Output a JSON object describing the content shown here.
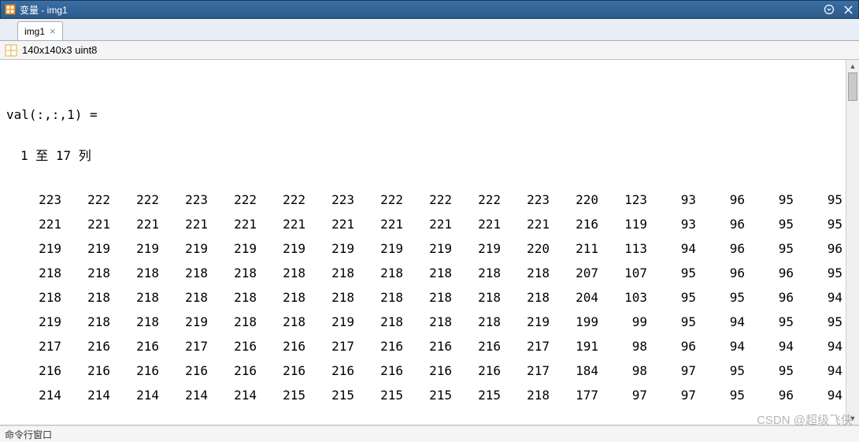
{
  "window": {
    "title": "变量 - img1"
  },
  "tab": {
    "label": "img1"
  },
  "toolbar": {
    "info": "140x140x3 uint8"
  },
  "content": {
    "header": "val(:,:,1) =",
    "subheader": "1 至 17 列",
    "rows": [
      [
        "223",
        "222",
        "222",
        "223",
        "222",
        "222",
        "223",
        "222",
        "222",
        "222",
        "223",
        "220",
        "123",
        "93",
        "96",
        "95",
        "95"
      ],
      [
        "221",
        "221",
        "221",
        "221",
        "221",
        "221",
        "221",
        "221",
        "221",
        "221",
        "221",
        "216",
        "119",
        "93",
        "96",
        "95",
        "95"
      ],
      [
        "219",
        "219",
        "219",
        "219",
        "219",
        "219",
        "219",
        "219",
        "219",
        "219",
        "220",
        "211",
        "113",
        "94",
        "96",
        "95",
        "96"
      ],
      [
        "218",
        "218",
        "218",
        "218",
        "218",
        "218",
        "218",
        "218",
        "218",
        "218",
        "218",
        "207",
        "107",
        "95",
        "96",
        "96",
        "95"
      ],
      [
        "218",
        "218",
        "218",
        "218",
        "218",
        "218",
        "218",
        "218",
        "218",
        "218",
        "218",
        "204",
        "103",
        "95",
        "95",
        "96",
        "94"
      ],
      [
        "219",
        "218",
        "218",
        "219",
        "218",
        "218",
        "219",
        "218",
        "218",
        "218",
        "219",
        "199",
        "99",
        "95",
        "94",
        "95",
        "95"
      ],
      [
        "217",
        "216",
        "216",
        "217",
        "216",
        "216",
        "217",
        "216",
        "216",
        "216",
        "217",
        "191",
        "98",
        "96",
        "94",
        "94",
        "94"
      ],
      [
        "216",
        "216",
        "216",
        "216",
        "216",
        "216",
        "216",
        "216",
        "216",
        "216",
        "217",
        "184",
        "98",
        "97",
        "95",
        "95",
        "94"
      ],
      [
        "214",
        "214",
        "214",
        "214",
        "214",
        "215",
        "215",
        "215",
        "215",
        "215",
        "218",
        "177",
        "97",
        "97",
        "95",
        "96",
        "94"
      ]
    ]
  },
  "statusbar": {
    "text": "命令行窗口"
  },
  "watermark": "CSDN @超级飞侠"
}
